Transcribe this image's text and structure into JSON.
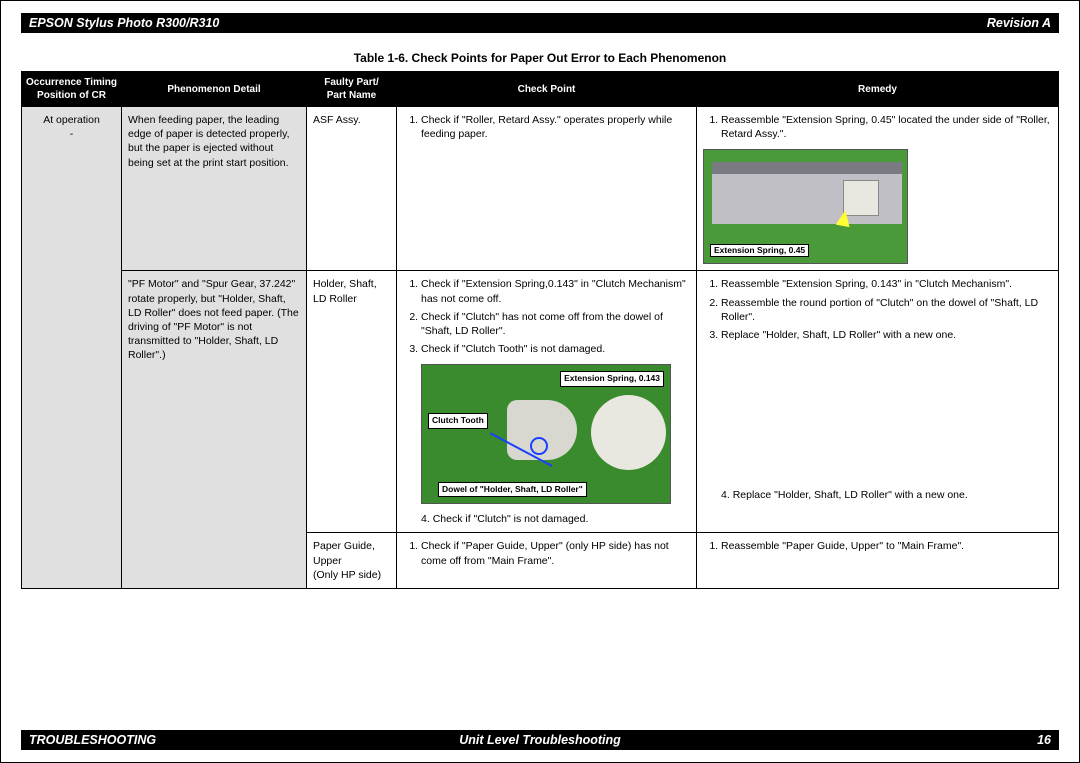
{
  "header": {
    "left": "EPSON Stylus Photo R300/R310",
    "right": "Revision A"
  },
  "caption": "Table 1-6.  Check Points for Paper Out Error to Each Phenomenon",
  "columns": {
    "c1a": "Occurrence Timing",
    "c1b": "Position of CR",
    "c2": "Phenomenon Detail",
    "c3a": "Faulty Part/",
    "c3b": "Part Name",
    "c4": "Check Point",
    "c5": "Remedy"
  },
  "occ": {
    "line1": "At operation",
    "line2": "-"
  },
  "rows": [
    {
      "phenomenon": "When feeding paper, the leading edge of paper is detected properly, but the paper is ejected without being set at the print start position.",
      "part": "ASF Assy.",
      "check": [
        "Check if \"Roller, Retard Assy.\" operates properly while feeding paper."
      ],
      "remedy": [
        "Reassemble \"Extension Spring, 0.45\" located the under side of \"Roller, Retard Assy.\"."
      ],
      "fig1_label": "Extension Spring, 0.45"
    },
    {
      "phenomenon": "\"PF Motor\" and \"Spur Gear, 37.242\" rotate properly, but \"Holder, Shaft, LD Roller\" does not feed paper. (The driving of \"PF Motor\" is not transmitted to \"Holder, Shaft, LD Roller\".)",
      "part": "Holder, Shaft, LD Roller",
      "check_a": [
        "Check if \"Extension Spring,0.143\" in \"Clutch Mechanism\" has not come off.",
        "Check if \"Clutch\" has not come off from the dowel of \"Shaft, LD Roller\".",
        "Check if \"Clutch Tooth\" is not damaged."
      ],
      "check_b_start": "4.",
      "check_b": "Check if \"Clutch\" is not damaged.",
      "remedy_a": [
        "Reassemble \"Extension Spring, 0.143\" in \"Clutch Mechanism\".",
        "Reassemble the round portion of \"Clutch\" on the dowel of \"Shaft, LD Roller\".",
        "Replace \"Holder, Shaft, LD Roller\" with a new one."
      ],
      "remedy_b_start": "4.",
      "remedy_b": "Replace \"Holder, Shaft, LD Roller\" with a new one.",
      "fig2_labels": {
        "a": "Extension Spring, 0.143",
        "b": "Clutch Tooth",
        "c": "Dowel of \"Holder, Shaft, LD Roller\""
      }
    },
    {
      "part_l1": "Paper Guide,",
      "part_l2": "Upper",
      "part_l3": "(Only HP side)",
      "check": [
        "Check if \"Paper Guide, Upper\" (only HP side) has not come off from \"Main Frame\"."
      ],
      "remedy": [
        "Reassemble \"Paper Guide, Upper\" to \"Main Frame\"."
      ]
    }
  ],
  "footer": {
    "left": "TROUBLESHOOTING",
    "center": "Unit Level Troubleshooting",
    "right": "16"
  }
}
